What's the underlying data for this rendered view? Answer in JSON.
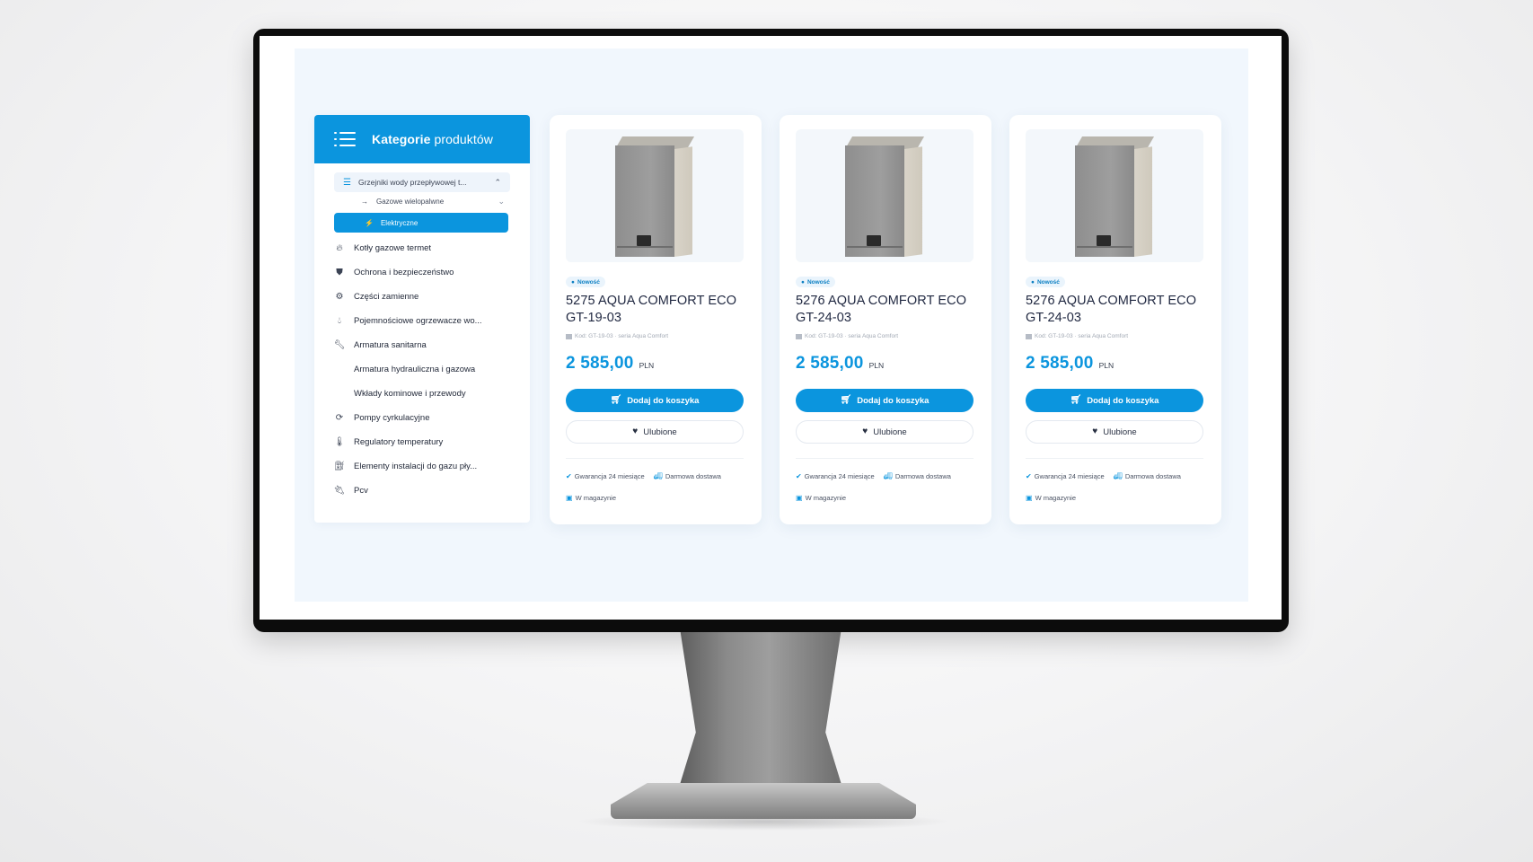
{
  "sidebar": {
    "title_bold": "Kategorie",
    "title_light": " produktów",
    "expanded_category": {
      "label": "Grzejniki wody przepływowej t...",
      "icon": "heater-lines-icon"
    },
    "subcategories": [
      {
        "label": "Gazowe wielopalwne",
        "icon": "arrow-right-icon"
      },
      {
        "label": "Elektryczne",
        "icon": "bolt-icon",
        "active": true
      }
    ],
    "items": [
      {
        "label": "Kotły gazowe termet",
        "icon": "flame-icon"
      },
      {
        "label": "Ochrona i bezpieczeństwo",
        "icon": "shield-icon"
      },
      {
        "label": "Części zamienne",
        "icon": "gears-icon"
      },
      {
        "label": "Pojemnościowe ogrzewacze wo...",
        "icon": "droplet-icon"
      },
      {
        "label": "Armatura sanitarna",
        "icon": "wrench-icon"
      },
      {
        "label": "Armatura hydrauliczna i gazowa",
        "icon": ""
      },
      {
        "label": "Wkłady kominowe i przewody",
        "icon": ""
      },
      {
        "label": "Pompy cyrkulacyjne",
        "icon": "sync-icon"
      },
      {
        "label": "Regulatory temperatury",
        "icon": "thermometer-icon"
      },
      {
        "label": "Elementy instalacji do gazu pły...",
        "icon": "gas-pump-icon"
      },
      {
        "label": "Pcv",
        "icon": "plug-icon"
      }
    ]
  },
  "products": [
    {
      "badge": "Nowość",
      "title": "5275 AQUA COMFORT ECO GT-19-03",
      "sku": "Kod: GT-19-03 · seria Aqua Comfort",
      "price": "2 585,00",
      "currency": "PLN",
      "cart_label": "Dodaj do koszyka",
      "fav_label": "Ulubione",
      "warranty": "Gwarancja 24 miesiące",
      "delivery": "Darmowa dostawa",
      "stock": "W magazynie"
    },
    {
      "badge": "Nowość",
      "title": "5276 AQUA COMFORT ECO GT-24-03",
      "sku": "Kod: GT-19-03 · seria Aqua Comfort",
      "price": "2 585,00",
      "currency": "PLN",
      "cart_label": "Dodaj do koszyka",
      "fav_label": "Ulubione",
      "warranty": "Gwarancja 24 miesiące",
      "delivery": "Darmowa dostawa",
      "stock": "W magazynie"
    },
    {
      "badge": "Nowość",
      "title": "5276 AQUA COMFORT ECO GT-24-03",
      "sku": "Kod: GT-19-03 · seria Aqua Comfort",
      "price": "2 585,00",
      "currency": "PLN",
      "cart_label": "Dodaj do koszyka",
      "fav_label": "Ulubione",
      "warranty": "Gwarancja 24 miesiące",
      "delivery": "Darmowa dostawa",
      "stock": "W magazynie"
    }
  ],
  "colors": {
    "accent": "#0b95de",
    "page_bg": "#f1f7fd",
    "text_dark": "#1f2740"
  }
}
